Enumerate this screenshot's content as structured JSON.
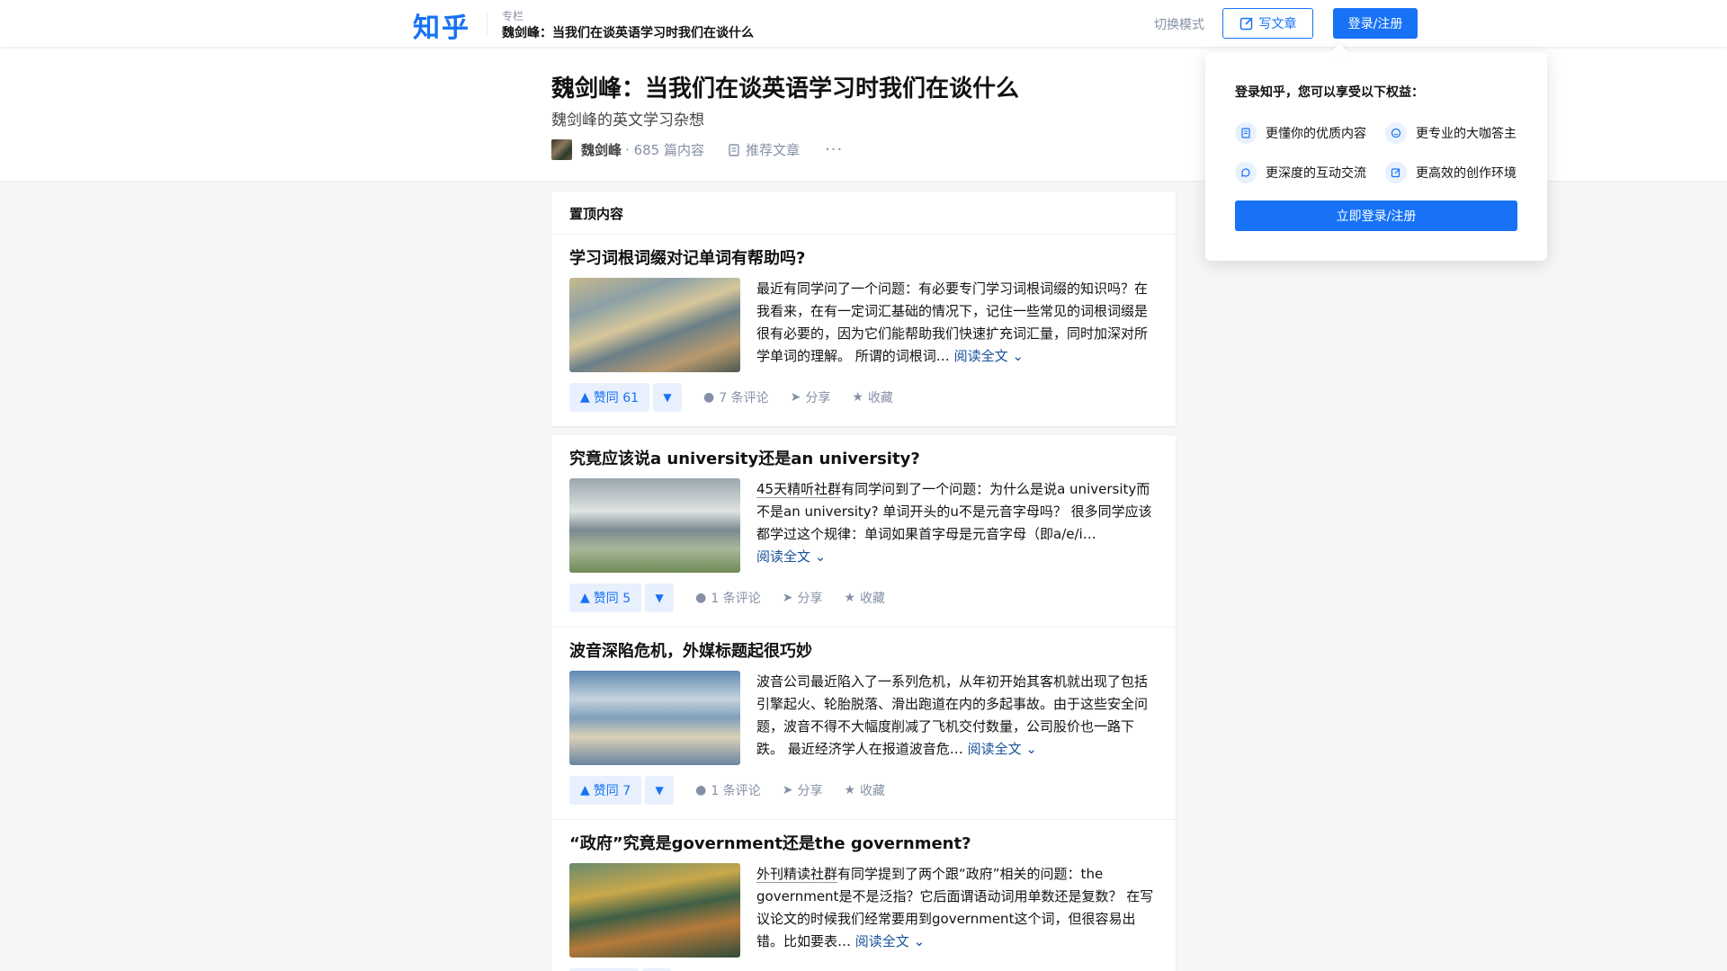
{
  "topbar": {
    "logo": "知乎",
    "column_label": "专栏",
    "column_title": "魏剑峰：当我们在谈英语学习时我们在谈什么",
    "switch_mode": "切换模式",
    "write_label": "写文章",
    "login_label": "登录/注册"
  },
  "header": {
    "title": "魏剑峰：当我们在谈英语学习时我们在谈什么",
    "subtitle": "魏剑峰的英文学习杂想",
    "author": "魏剑峰",
    "separator": "·",
    "count": "685",
    "count_suffix": "篇内容",
    "recommend": "推荐文章",
    "more": "···"
  },
  "feed": {
    "pinned_label": "置顶内容",
    "items": [
      {
        "title": "学习词根词缀对记单词有帮助吗?",
        "link_text": "",
        "excerpt": "最近有同学问了一个问题：有必要专门学习词根词缀的知识吗？在我看来，在有一定词汇基础的情况下，记住一些常见的词根词缀是很有必要的，因为它们能帮助我们快速扩充词汇量，同时加深对所学单词的理解。 所谓的词根词…",
        "read_more": "阅读全文",
        "vote": "赞同 61",
        "comments": "7 条评论",
        "share": "分享",
        "favorite": "收藏"
      },
      {
        "title": "究竟应该说a university还是an university?",
        "link_text": "45天精听社群",
        "excerpt": "有同学问到了一个问题：为什么是说a university而不是an university? 单词开头的u不是元音字母吗？ 很多同学应该都学过这个规律：单词如果首字母是元音字母（即a/e/i…",
        "read_more": "阅读全文",
        "vote": "赞同 5",
        "comments": "1 条评论",
        "share": "分享",
        "favorite": "收藏"
      },
      {
        "title": "波音深陷危机，外媒标题起很巧妙",
        "link_text": "",
        "excerpt": "波音公司最近陷入了一系列危机，从年初开始其客机就出现了包括引擎起火、轮胎脱落、滑出跑道在内的多起事故。由于这些安全问题，波音不得不大幅度削减了飞机交付数量，公司股价也一路下跌。 最近经济学人在报道波音危…",
        "read_more": "阅读全文",
        "vote": "赞同 7",
        "comments": "1 条评论",
        "share": "分享",
        "favorite": "收藏"
      },
      {
        "title": "“政府”究竟是government还是the government?",
        "link_text": "外刊精读社群",
        "excerpt": "有同学提到了两个跟“政府”相关的问题：the government是不是泛指？它后面谓语动词用单数还是复数？ 在写议论文的时候我们经常要用到government这个词，但很容易出错。比如要表…",
        "read_more": "阅读全文",
        "vote": "",
        "comments": "",
        "share": "",
        "favorite": ""
      }
    ]
  },
  "popover": {
    "title": "登录知乎，您可以享受以下权益：",
    "benefits": [
      "更懂你的优质内容",
      "更专业的大咖答主",
      "更深度的互动交流",
      "更高效的创作环境"
    ],
    "button": "立即登录/注册"
  },
  "colors": {
    "brand": "#1772f6",
    "link": "#175199",
    "muted": "#8590a6",
    "vote_bg": "#e8f0fd"
  }
}
